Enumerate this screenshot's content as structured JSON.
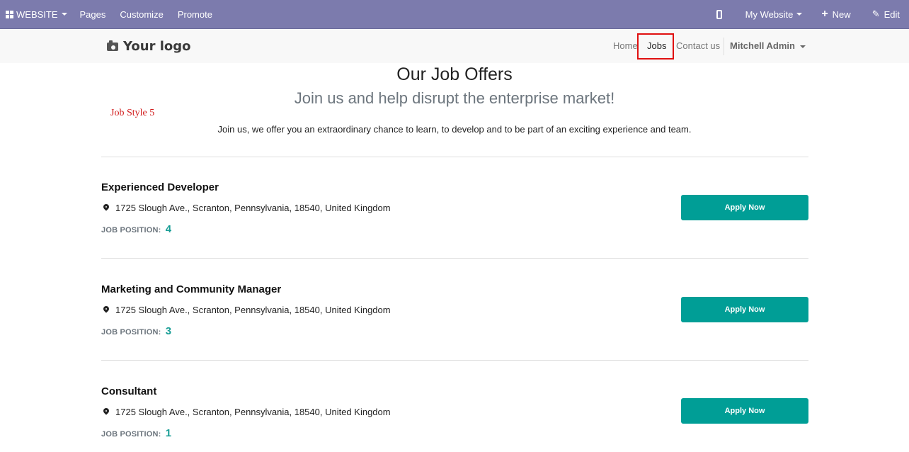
{
  "admin_bar": {
    "website_menu": "WEBSITE",
    "pages": "Pages",
    "customize": "Customize",
    "promote": "Promote",
    "my_website": "My Website",
    "new": "New",
    "edit": "Edit"
  },
  "header": {
    "logo_text": "Your logo",
    "nav": {
      "home": "Home",
      "jobs": "Jobs",
      "contact": "Contact us",
      "user": "Mitchell Admin"
    }
  },
  "main": {
    "title": "Our Job Offers",
    "subtitle": "Join us and help disrupt the enterprise market!",
    "style_tag": "Job Style 5",
    "intro": "Join us, we offer you an extraordinary chance to learn, to develop and to be part of an exciting experience and team."
  },
  "jobs": [
    {
      "title": "Experienced Developer",
      "address": "1725 Slough Ave., Scranton, Pennsylvania, 18540, United Kingdom",
      "position_label": "JOB POSITION:",
      "position_count": "4",
      "apply_label": "Apply Now"
    },
    {
      "title": "Marketing and Community Manager",
      "address": "1725 Slough Ave., Scranton, Pennsylvania, 18540, United Kingdom",
      "position_label": "JOB POSITION:",
      "position_count": "3",
      "apply_label": "Apply Now"
    },
    {
      "title": "Consultant",
      "address": "1725 Slough Ave., Scranton, Pennsylvania, 18540, United Kingdom",
      "position_label": "JOB POSITION:",
      "position_count": "1",
      "apply_label": "Apply Now"
    }
  ],
  "colors": {
    "admin_bar": "#7C7BAD",
    "accent": "#009E96",
    "highlight_border": "#e01010",
    "style_tag": "#d11a1a"
  }
}
